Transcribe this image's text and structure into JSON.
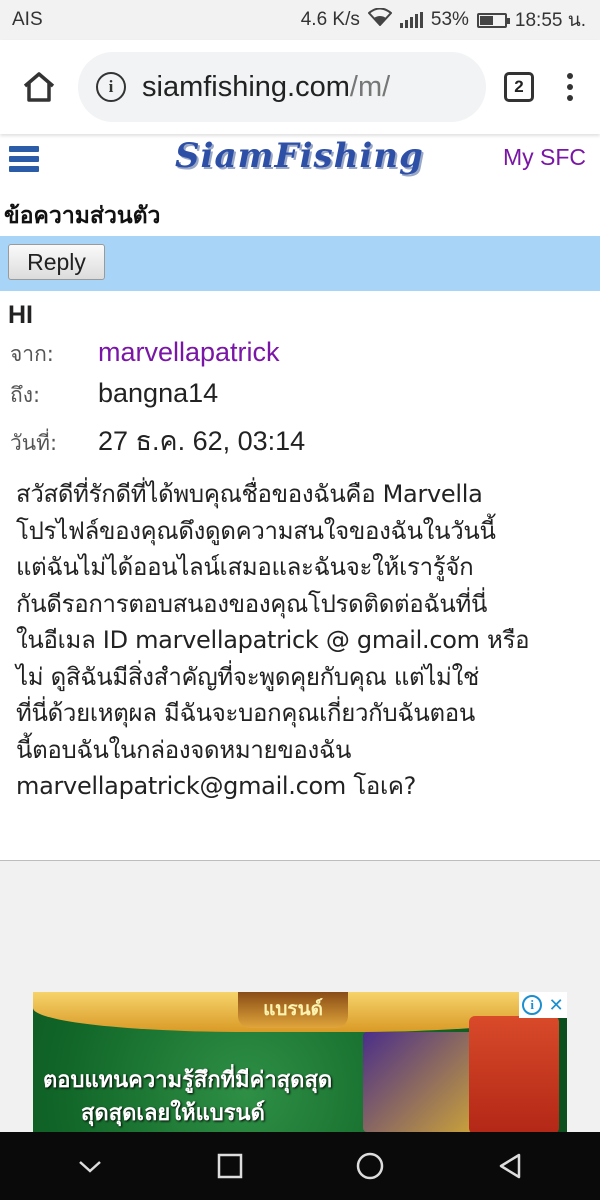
{
  "status_bar": {
    "carrier": "AIS",
    "speed": "4.6 K/s",
    "battery_percent": "53%",
    "battery_level": 0.53,
    "time": "18:55 น."
  },
  "browser": {
    "url_host": "siamfishing.com",
    "url_rest": "/m/",
    "tab_count": "2"
  },
  "site": {
    "logo": "SiamFishing",
    "my_sfc": "My SFC"
  },
  "page": {
    "title": "ข้อความส่วนตัว",
    "reply_label": "Reply"
  },
  "message": {
    "subject": "HI",
    "from_label": "จาก:",
    "from_value": "marvellapatrick",
    "to_label": "ถึง:",
    "to_value": "bangna14",
    "date_label": "วันที่:",
    "date_value": "27 ธ.ค. 62, 03:14",
    "body": "สวัสดีที่รักดีที่ได้พบคุณชื่อของฉันคือ Marvella\nโปรไฟล์ของคุณดึงดูดความสนใจของฉันในวันนี้\nแต่ฉันไม่ได้ออนไลน์เสมอและฉันจะให้เรารู้จัก\nกันดีรอการตอบสนองของคุณโปรดติดต่อฉันที่นี่\nในอีเมล ID marvellapatrick @ gmail.com หรือ\nไม่ ดูสิฉันมีสิ่งสำคัญที่จะพูดคุยกับคุณ แต่ไม่ใช่\nที่นี่ด้วยเหตุผล มีฉันจะบอกคุณเกี่ยวกับฉันตอน\nนี้ตอบฉันในกล่องจดหมายของฉัน\nmarvellapatrick@gmail.com โอเค?"
  },
  "ad": {
    "brand": "แบรนด์",
    "line1": "ตอบแทนความรู้สึกที่มีค่าสุดสุด",
    "line2": "สุดสุดเลยให้แบรนด์"
  },
  "colors": {
    "accent_link": "#7a16a6",
    "reply_strip": "#a8d4f8",
    "logo": "#2d4fa6"
  }
}
